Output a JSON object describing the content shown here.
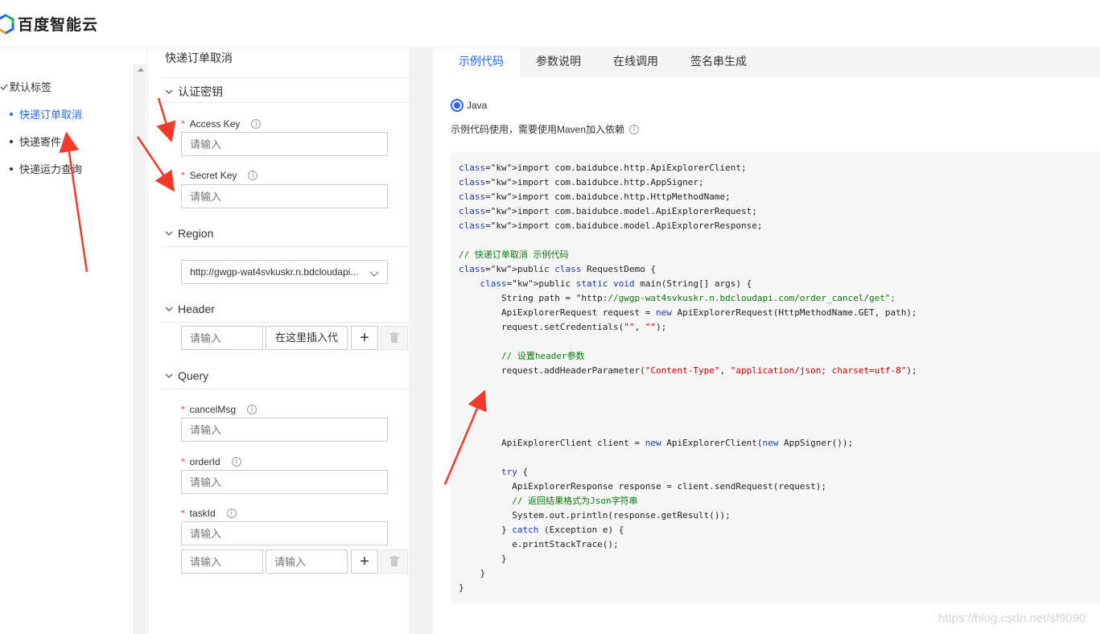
{
  "brand": {
    "name": "百度智能云"
  },
  "sidebar": {
    "group_label": "默认标签",
    "items": [
      {
        "label": "快递订单取消",
        "active": true
      },
      {
        "label": "快递寄件",
        "active": false
      },
      {
        "label": "快递运力查询",
        "active": false
      }
    ]
  },
  "form": {
    "title": "快递订单取消",
    "auth": {
      "label": "认证密钥",
      "access_key": {
        "label": "Access Key",
        "placeholder": "请输入"
      },
      "secret_key": {
        "label": "Secret Key",
        "placeholder": "请输入"
      }
    },
    "region": {
      "label": "Region",
      "selected": "http://gwgp-wat4svkuskr.n.bdcloudapi..."
    },
    "header": {
      "label": "Header",
      "key_placeholder": "请输入",
      "insert_label": "在这里插入代"
    },
    "query": {
      "label": "Query",
      "fields": [
        {
          "label": "cancelMsg",
          "placeholder": "请输入"
        },
        {
          "label": "orderId",
          "placeholder": "请输入"
        },
        {
          "label": "taskId",
          "placeholder": "请输入"
        }
      ],
      "extra_key_placeholder": "请输入",
      "extra_value_placeholder": "请输入"
    },
    "info_glyph": "i",
    "add_glyph": "+",
    "required_mark": "*"
  },
  "tabs": [
    {
      "label": "示例代码",
      "active": true
    },
    {
      "label": "参数说明",
      "active": false
    },
    {
      "label": "在线调用",
      "active": false
    },
    {
      "label": "签名串生成",
      "active": false
    }
  ],
  "code_panel": {
    "language": "Java",
    "hint": "示例代码使用，需要使用Maven加入依赖",
    "lines": [
      "import com.baidubce.http.ApiExplorerClient;",
      "import com.baidubce.http.AppSigner;",
      "import com.baidubce.http.HttpMethodName;",
      "import com.baidubce.model.ApiExplorerRequest;",
      "import com.baidubce.model.ApiExplorerResponse;",
      "",
      "// 快递订单取消 示例代码",
      "public class RequestDemo {",
      "    public static void main(String[] args) {",
      "        String path = \"http://gwgp-wat4svkuskr.n.bdcloudapi.com/order_cancel/get\";",
      "        ApiExplorerRequest request = new ApiExplorerRequest(HttpMethodName.GET, path);",
      "        request.setCredentials(\"\", \"\");",
      "",
      "        // 设置header参数",
      "        request.addHeaderParameter(\"Content-Type\", \"application/json; charset=utf-8\");",
      "",
      "",
      "",
      "",
      "        ApiExplorerClient client = new ApiExplorerClient(new AppSigner());",
      "",
      "        try {",
      "          ApiExplorerResponse response = client.sendRequest(request);",
      "          // 返回结果格式为Json字符串",
      "          System.out.println(response.getResult());",
      "        } catch (Exception e) {",
      "          e.printStackTrace();",
      "        }",
      "    }",
      "}"
    ]
  },
  "watermark": "https://blog.csdn.net/sf9090",
  "colors": {
    "accent": "#2468f2",
    "annotation": "#f23a2a"
  }
}
